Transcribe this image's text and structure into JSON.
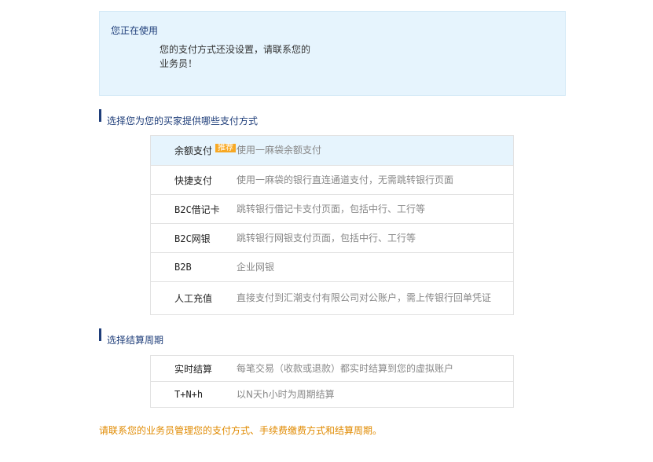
{
  "info": {
    "title": "您正在使用",
    "message_line1": "您的支付方式还没设置，请联系您的",
    "message_line2": "业务员！"
  },
  "payment_section": {
    "heading": "选择您为您的买家提供哪些支付方式",
    "options": [
      {
        "name": "余额支付",
        "badge": "推荐",
        "desc": "使用一麻袋余额支付",
        "selected": true
      },
      {
        "name": "快捷支付",
        "desc": "使用一麻袋的银行直连通道支付，无需跳转银行页面"
      },
      {
        "name": "B2C借记卡",
        "desc": "跳转银行借记卡支付页面，包括中行、工行等"
      },
      {
        "name": "B2C网银",
        "desc": "跳转银行网银支付页面，包括中行、工行等"
      },
      {
        "name": "B2B",
        "desc": "企业网银"
      },
      {
        "name": "人工充值",
        "desc": "直接支付到汇潮支付有限公司对公账户，需上传银行回单凭证"
      }
    ]
  },
  "settlement_section": {
    "heading": "选择结算周期",
    "options": [
      {
        "name": "实时结算",
        "desc": "每笔交易（收款或退款）都实时结算到您的虚拟账户"
      },
      {
        "name": "T+N+h",
        "desc": "以N天h小时为周期结算"
      }
    ]
  },
  "footer_note": "请联系您的业务员管理您的支付方式、手续费缴费方式和结算周期。",
  "colors": {
    "accent": "#1f3e7a",
    "info_bg": "#e6f4fd",
    "badge": "#f7a823",
    "notice": "#e08a00"
  }
}
